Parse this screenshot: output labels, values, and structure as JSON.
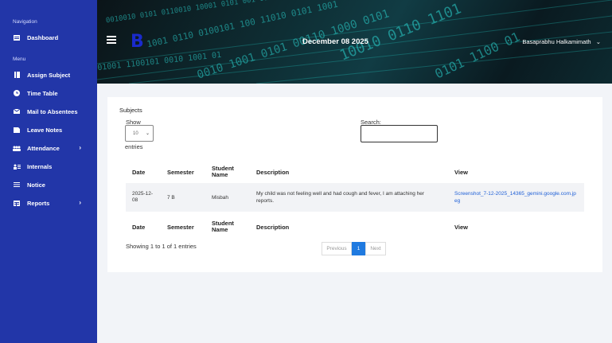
{
  "sidebar": {
    "nav_heading": "Navigation",
    "menu_heading": "Menu",
    "items": [
      {
        "label": "Dashboard",
        "icon": "dashboard-icon"
      },
      {
        "label": "Assign Subject",
        "icon": "book-icon"
      },
      {
        "label": "Time Table",
        "icon": "clock-icon"
      },
      {
        "label": "Mail to Absentees",
        "icon": "mail-icon"
      },
      {
        "label": "Leave Notes",
        "icon": "note-icon"
      },
      {
        "label": "Attendance",
        "icon": "users-icon"
      },
      {
        "label": "Internals",
        "icon": "user-list-icon"
      },
      {
        "label": "Notice",
        "icon": "notice-icon"
      },
      {
        "label": "Reports",
        "icon": "report-icon"
      }
    ]
  },
  "header": {
    "logo": "B",
    "date": "December 08 2025",
    "user": "Basaprabhu Halkamimath"
  },
  "card": {
    "title": "Subjects",
    "show_label": "Show",
    "entries_value": "10",
    "entries_label": "entries",
    "search_label": "Search:",
    "search_value": ""
  },
  "table": {
    "columns": [
      "Date",
      "Semester",
      "Student Name",
      "Description",
      "View"
    ],
    "rows": [
      {
        "date": "2025-12-08",
        "semester": "7 B",
        "student": "Misbah",
        "description": "My child was not feeling well and had cough and fever, I am attaching her reports.",
        "view": "Screenshot_7-12-2025_14365_gemini.google.com.jpeg"
      }
    ]
  },
  "footer": {
    "info": "Showing 1 to 1 of 1 entries",
    "prev": "Previous",
    "page": "1",
    "next": "Next"
  },
  "colors": {
    "sidebar": "#2236a8",
    "accent": "#1f7ae0",
    "banner_code": "#2bd3cf"
  }
}
